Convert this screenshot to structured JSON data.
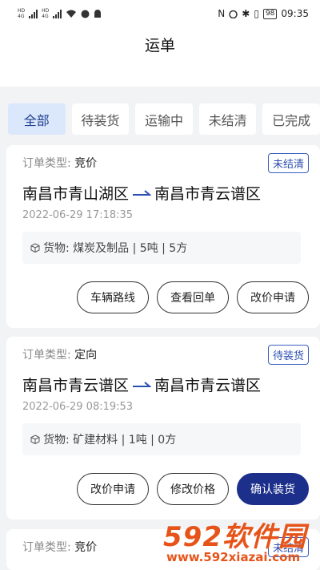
{
  "status_bar": {
    "left_labels": [
      "HD",
      "4G",
      "HD",
      "4G"
    ],
    "battery": "98",
    "time": "09:35"
  },
  "header": {
    "title": "运单"
  },
  "tabs": [
    {
      "label": "全部",
      "active": true
    },
    {
      "label": "待装货",
      "active": false
    },
    {
      "label": "运输中",
      "active": false
    },
    {
      "label": "未结清",
      "active": false
    },
    {
      "label": "已完成",
      "active": false
    }
  ],
  "orders": [
    {
      "type_label": "订单类型:",
      "type_value": "竞价",
      "status": "未结清",
      "from": "南昌市青山湖区",
      "to": "南昌市青云谱区",
      "datetime": "2022-06-29 17:18:35",
      "goods": "货物: 煤炭及制品 | 5吨 | 5方",
      "actions": [
        "车辆路线",
        "查看回单",
        "改价申请"
      ]
    },
    {
      "type_label": "订单类型:",
      "type_value": "定向",
      "status": "待装货",
      "from": "南昌市青云谱区",
      "to": "南昌市青云谱区",
      "datetime": "2022-06-29 08:19:53",
      "goods": "货物: 矿建材料 | 1吨 | 0方",
      "actions": [
        "改价申请",
        "修改价格",
        "确认装货"
      ]
    },
    {
      "type_label": "订单类型:",
      "type_value": "竞价",
      "status": "未结清"
    }
  ],
  "watermark": {
    "brand": "592软件园",
    "url": "www.592xiazai.com"
  },
  "colors": {
    "accent": "#1c2f8a",
    "badge": "#2c4fb0",
    "tab_active_bg": "#dbe7fb",
    "watermark": "#e6541a"
  }
}
